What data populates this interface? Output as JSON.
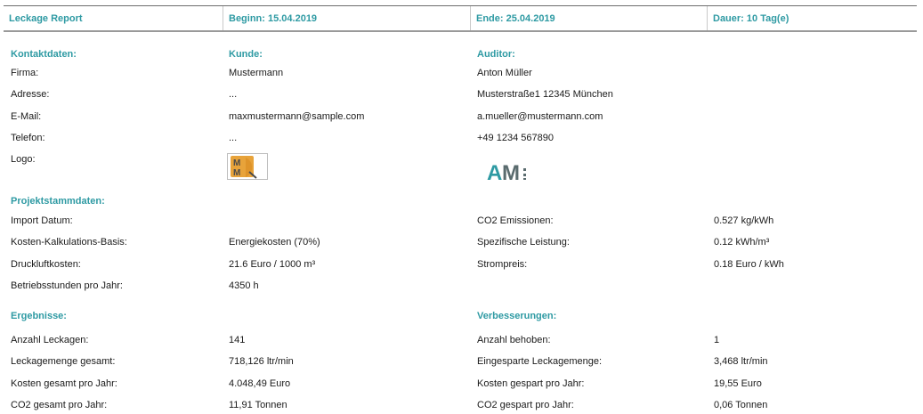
{
  "header": {
    "title": "Leckage Report",
    "begin": "Beginn: 15.04.2019",
    "end": "Ende: 25.04.2019",
    "duration": "Dauer: 10 Tag(e)"
  },
  "contact": {
    "section_label": "Kontaktdaten:",
    "customer_label": "Kunde:",
    "auditor_label": "Auditor:",
    "rows": [
      {
        "label": "Firma:",
        "customer": "Mustermann",
        "auditor": "Anton Müller"
      },
      {
        "label": "Adresse:",
        "customer": "...",
        "auditor": "Musterstraße1 12345 München"
      },
      {
        "label": "E-Mail:",
        "customer": "maxmustermann@sample.com",
        "auditor": "a.mueller@mustermann.com"
      },
      {
        "label": "Telefon:",
        "customer": "...",
        "auditor": "+49 1234 567890"
      },
      {
        "label": "Logo:"
      }
    ],
    "customer_logo_text": "MM",
    "auditor_logo_text": "AM"
  },
  "project": {
    "section_label": "Projektstammdaten:",
    "rows": [
      {
        "label": "Import Datum:",
        "value": "",
        "label2": "CO2 Emissionen:",
        "value2": "0.527 kg/kWh"
      },
      {
        "label": "Kosten-Kalkulations-Basis:",
        "value": "Energiekosten (70%)",
        "label2": "Spezifische Leistung:",
        "value2": "0.12 kWh/m³"
      },
      {
        "label": "Druckluftkosten:",
        "value": "21.6 Euro / 1000 m³",
        "label2": "Strompreis:",
        "value2": "0.18 Euro / kWh"
      },
      {
        "label": "Betriebsstunden pro Jahr:",
        "value": "4350 h"
      }
    ]
  },
  "results": {
    "section_label": "Ergebnisse:",
    "improvements_label": "Verbesserungen:",
    "rows": [
      {
        "label": "Anzahl Leckagen:",
        "value": "141",
        "label2": "Anzahl behoben:",
        "value2": "1"
      },
      {
        "label": "Leckagemenge gesamt:",
        "value": "718,126 ltr/min",
        "label2": "Eingesparte Leckagemenge:",
        "value2": "3,468 ltr/min"
      },
      {
        "label": "Kosten gesamt pro Jahr:",
        "value": "4.048,49 Euro",
        "label2": "Kosten gespart pro Jahr:",
        "value2": "19,55 Euro"
      },
      {
        "label": "CO2 gesamt pro Jahr:",
        "value": "11,91 Tonnen",
        "label2": "CO2 gespart pro Jahr:",
        "value2": "0,06 Tonnen"
      }
    ]
  },
  "colors": {
    "accent": "#2e9aa3",
    "logo_orange": "#e8a33a",
    "logo_dark": "#5a6b6e",
    "am_teal": "#2e9aa3"
  }
}
